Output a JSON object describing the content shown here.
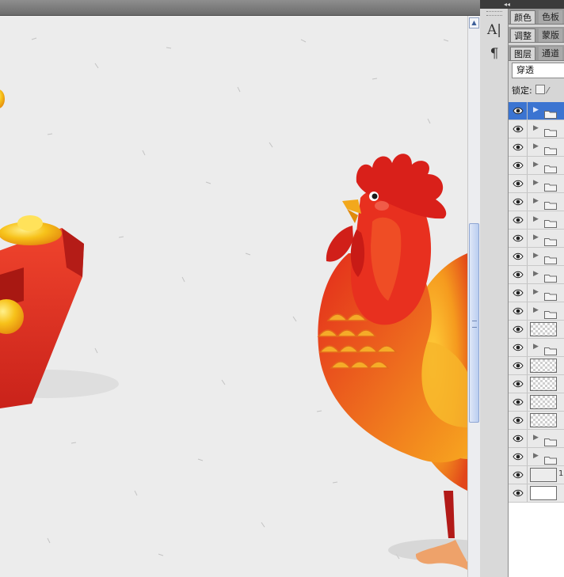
{
  "panels": {
    "collapse_glyph": "◂◂",
    "row1": {
      "tab_a": "颜色",
      "tab_b": "色板"
    },
    "row2": {
      "tab_a": "调整",
      "tab_b": "蒙版"
    },
    "row3": {
      "tab_a": "图层",
      "tab_b": "通道"
    },
    "blend_mode": "穿透",
    "lock_label": "锁定:"
  },
  "tools": [
    {
      "name": "character-tool",
      "glyph": "A|"
    },
    {
      "name": "paragraph-tool",
      "glyph": "¶"
    }
  ],
  "layers": [
    {
      "kind": "group",
      "selected": true
    },
    {
      "kind": "group"
    },
    {
      "kind": "group"
    },
    {
      "kind": "group"
    },
    {
      "kind": "group"
    },
    {
      "kind": "group"
    },
    {
      "kind": "group"
    },
    {
      "kind": "group"
    },
    {
      "kind": "group"
    },
    {
      "kind": "group"
    },
    {
      "kind": "group"
    },
    {
      "kind": "group"
    },
    {
      "kind": "layer",
      "thumb": "checker"
    },
    {
      "kind": "group"
    },
    {
      "kind": "layer",
      "thumb": "checker"
    },
    {
      "kind": "layer",
      "thumb": "checker"
    },
    {
      "kind": "layer",
      "thumb": "checker"
    },
    {
      "kind": "layer",
      "thumb": "checker"
    },
    {
      "kind": "group"
    },
    {
      "kind": "group"
    },
    {
      "kind": "layer",
      "thumb": "gray",
      "suffix": "1"
    },
    {
      "kind": "layer",
      "thumb": "white"
    }
  ],
  "colors": {
    "selection": "#3b74d1",
    "canvas_bg": "#ececec",
    "rooster_red": "#e8301f",
    "rooster_orange": "#f59a1e",
    "gold": "#f7c21a"
  }
}
